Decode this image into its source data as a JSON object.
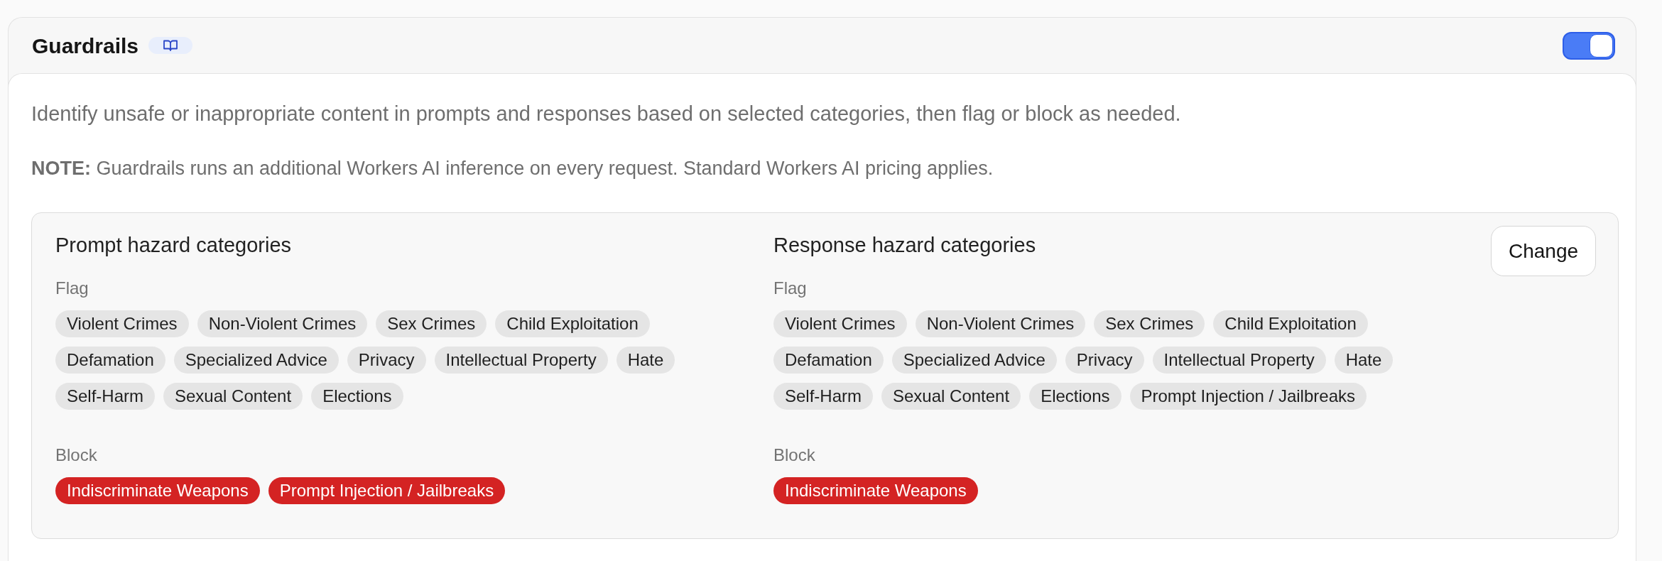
{
  "header": {
    "title": "Guardrails",
    "toggle": {
      "on": true
    }
  },
  "description": "Identify unsafe or inappropriate content in prompts and responses based on selected categories, then flag or block as needed.",
  "note": "**NOTE:** Guardrails runs an additional Workers AI inference on every request. Standard Workers AI pricing applies.",
  "hazard_panel": {
    "columns": [
      {
        "title": "Prompt hazard categories",
        "groups": [
          {
            "kind": "flag",
            "label": "Flag",
            "categories": [
              "Violent Crimes",
              "Non-Violent Crimes",
              "Sex Crimes",
              "Child Exploitation",
              "Defamation",
              "Specialized Advice",
              "Privacy",
              "Intellectual Property",
              "Hate",
              "Self-Harm",
              "Sexual Content",
              "Elections"
            ]
          },
          {
            "kind": "block",
            "label": "Block",
            "categories": [
              "Indiscriminate Weapons",
              "Prompt Injection / Jailbreaks"
            ]
          }
        ]
      },
      {
        "title": "Response hazard categories",
        "groups": [
          {
            "kind": "flag",
            "label": "Flag",
            "categories": [
              "Violent Crimes",
              "Non-Violent Crimes",
              "Sex Crimes",
              "Child Exploitation",
              "Defamation",
              "Specialized Advice",
              "Privacy",
              "Intellectual Property",
              "Hate",
              "Self-Harm",
              "Sexual Content",
              "Elections",
              "Prompt Injection / Jailbreaks"
            ]
          },
          {
            "kind": "block",
            "label": "Block",
            "categories": [
              "Indiscriminate Weapons"
            ]
          }
        ]
      }
    ],
    "change_button": "Change"
  }
}
